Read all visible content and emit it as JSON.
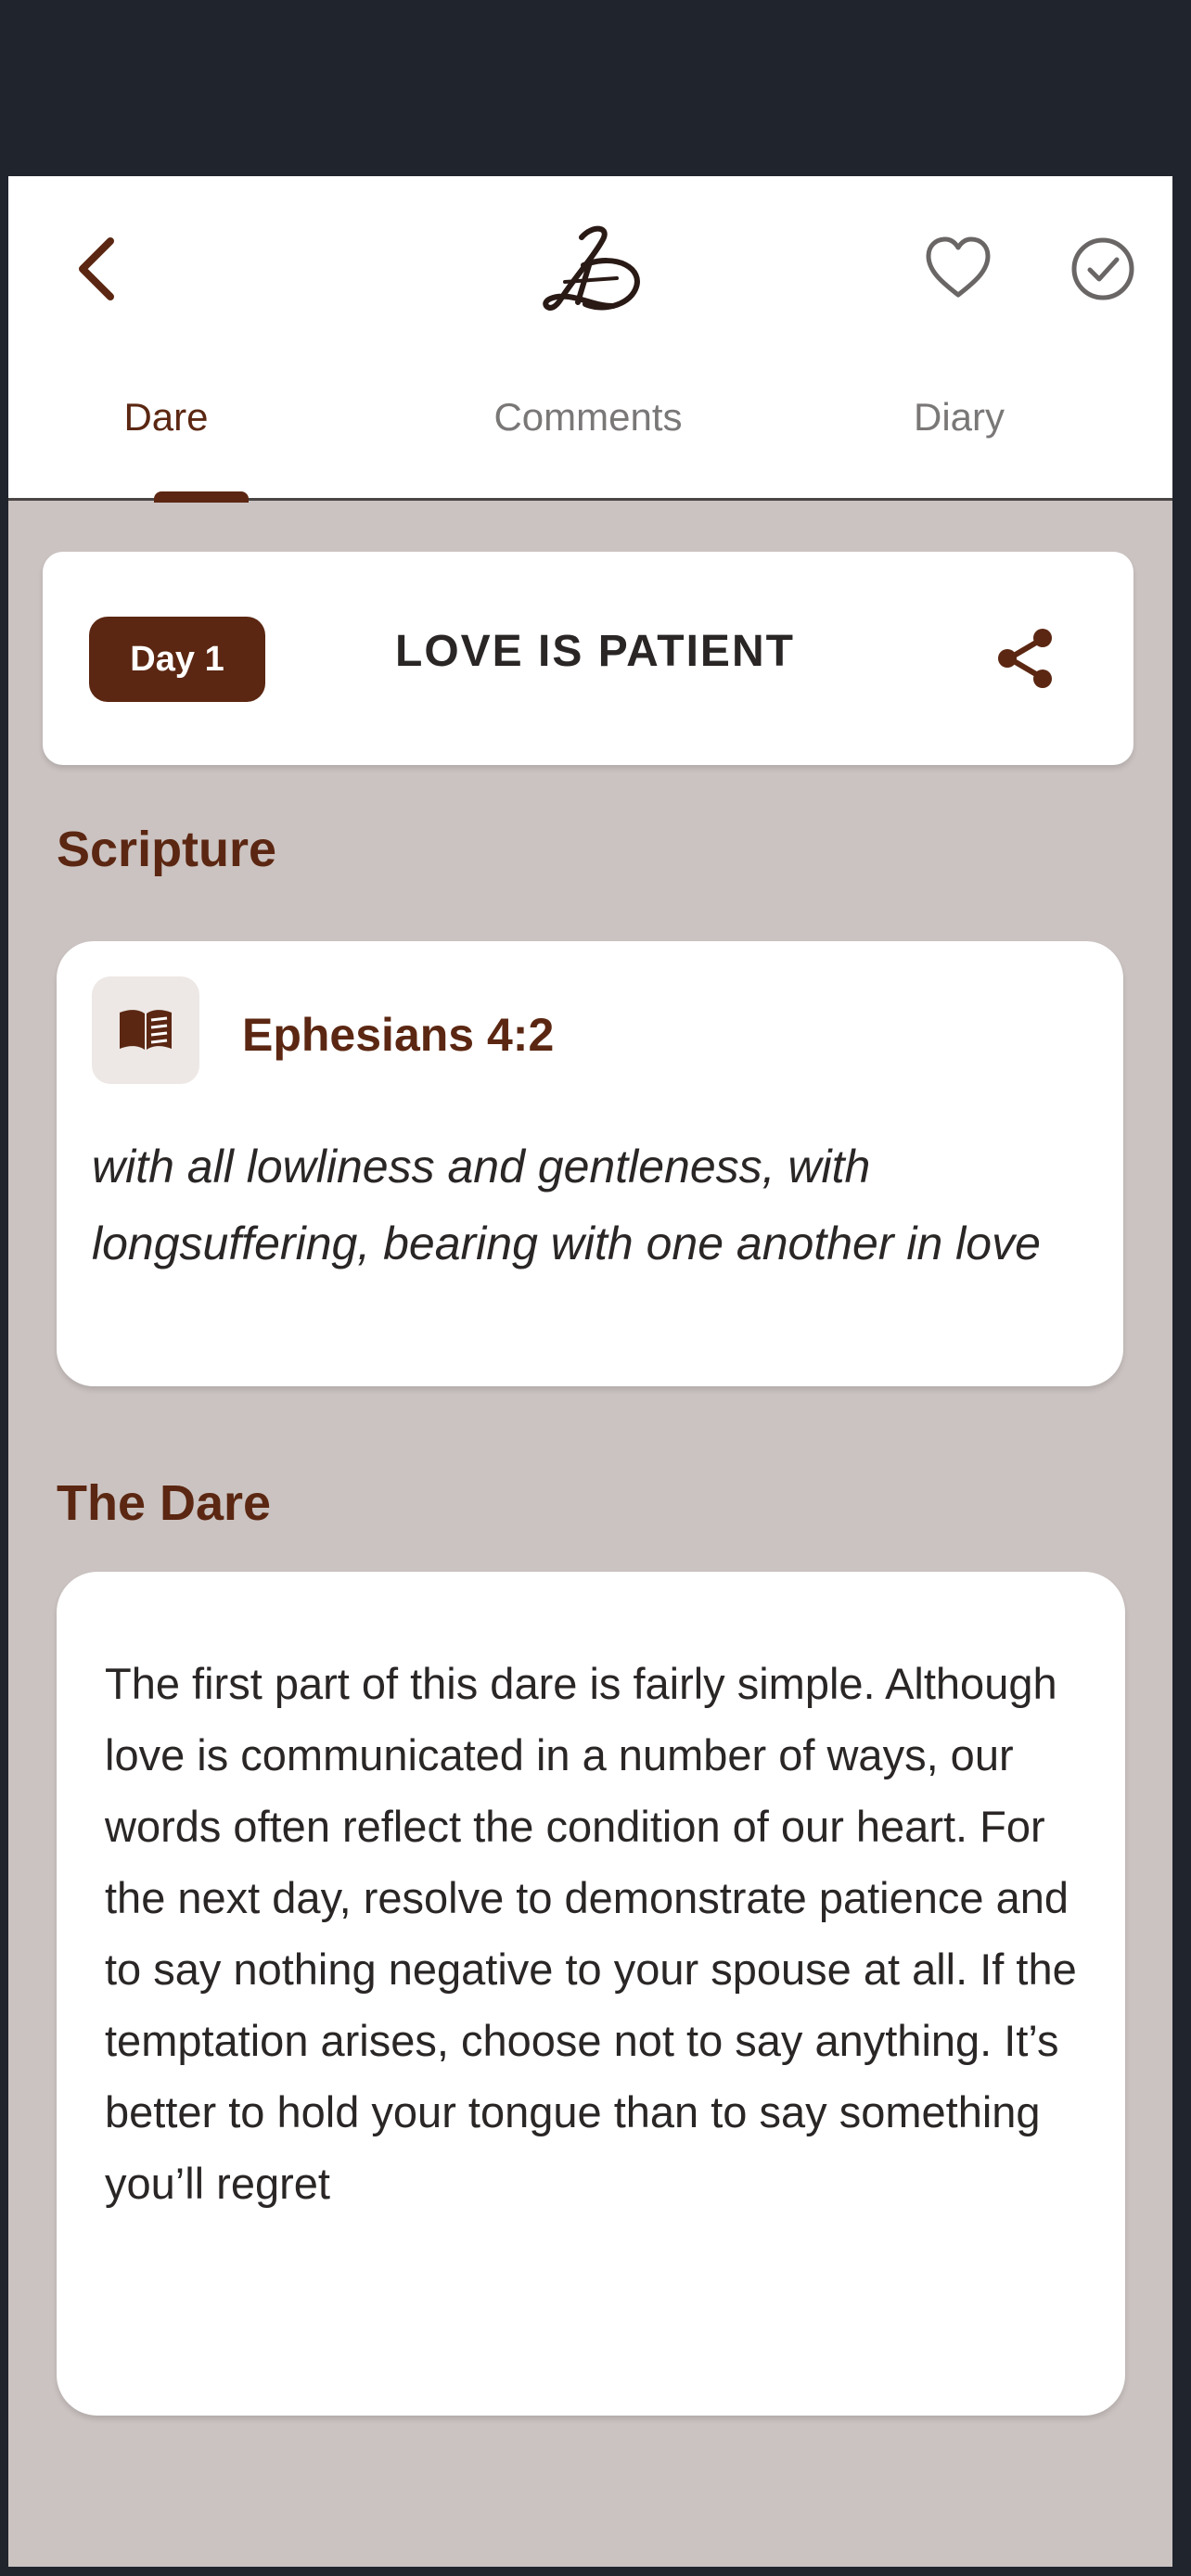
{
  "header": {
    "back_icon": "chevron-left-icon",
    "logo_icon": "ld-monogram-logo",
    "favorite_icon": "heart-outline-icon",
    "complete_icon": "check-circle-icon"
  },
  "tabs": [
    {
      "label": "Dare",
      "active": true
    },
    {
      "label": "Comments",
      "active": false
    },
    {
      "label": "Diary",
      "active": false
    }
  ],
  "day_card": {
    "badge": "Day 1",
    "title": "LOVE IS PATIENT",
    "share_icon": "share-icon"
  },
  "scripture": {
    "heading": "Scripture",
    "book_icon": "open-book-icon",
    "reference": "Ephesians 4:2",
    "verse": "with all lowliness and gentleness, with longsuffering, bearing with one another in love"
  },
  "dare": {
    "heading": "The Dare",
    "text": "The first part of this dare is fairly simple. Although love is communicated in a number of ways, our words often reflect the condition of our heart. For the next day, resolve to demonstrate patience and to say nothing negative to your spouse at all. If the temptation arises, choose not to say anything. It’s better to hold your tongue than to say something you’ll regret"
  },
  "colors": {
    "accent": "#5b2712",
    "background": "#cbc3c1",
    "frame": "#20242d"
  }
}
